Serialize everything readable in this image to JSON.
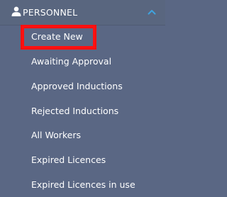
{
  "section": {
    "title": "PERSONNEL",
    "icon": "user-icon",
    "toggle_icon": "chevron-up-icon",
    "expanded": true
  },
  "menu_items": [
    {
      "label": "Create New",
      "highlighted": true
    },
    {
      "label": "Awaiting Approval"
    },
    {
      "label": "Approved Inductions"
    },
    {
      "label": "Rejected Inductions"
    },
    {
      "label": "All Workers"
    },
    {
      "label": "Expired Licences"
    },
    {
      "label": "Expired Licences in use"
    }
  ],
  "colors": {
    "sidebar_background": "#5a6784",
    "text": "#ffffff",
    "chevron": "#3fa4df",
    "highlight_border": "#ff1010"
  }
}
